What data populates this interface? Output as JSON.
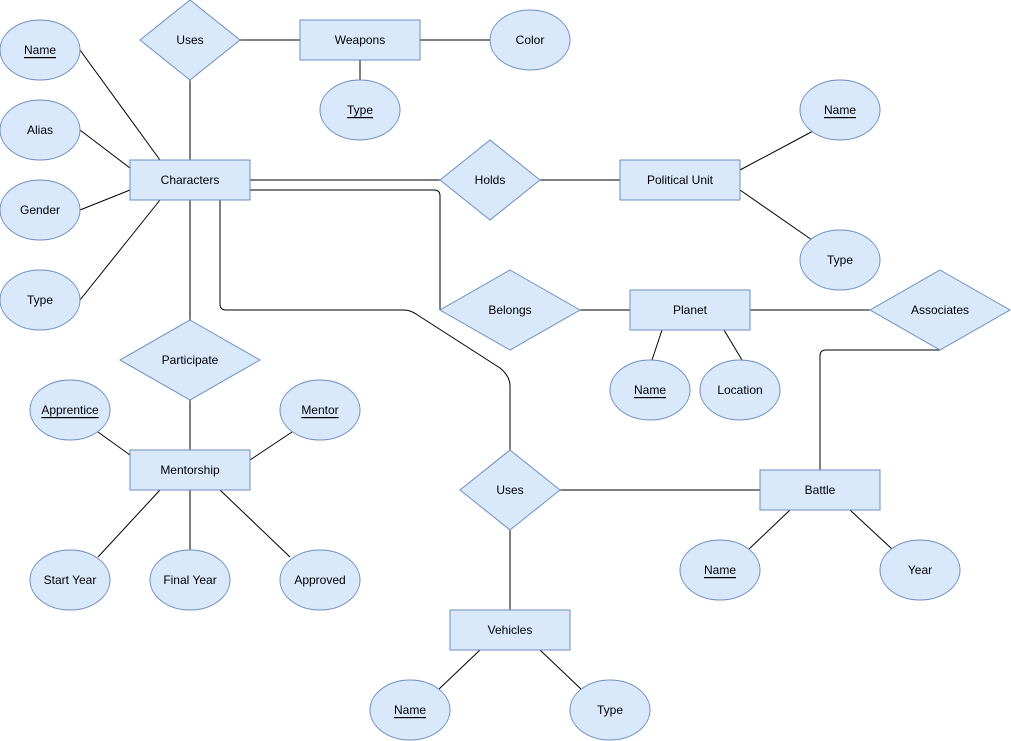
{
  "colors": {
    "fill": "#dae8fc",
    "stroke": "#6c8ebf",
    "edge": "#000000"
  },
  "entities": {
    "characters": "Characters",
    "weapons": "Weapons",
    "political_unit": "Political Unit",
    "planet": "Planet",
    "mentorship": "Mentorship",
    "battle": "Battle",
    "vehicles": "Vehicles"
  },
  "relationships": {
    "uses_weapons": "Uses",
    "holds": "Holds",
    "belongs": "Belongs",
    "associates": "Associates",
    "participate": "Participate",
    "uses_vehicles": "Uses"
  },
  "attributes": {
    "character_name": "Name",
    "character_alias": "Alias",
    "character_gender": "Gender",
    "character_type": "Type",
    "weapon_type": "Type",
    "weapon_color": "Color",
    "political_unit_name": "Name",
    "political_unit_type": "Type",
    "planet_name": "Name",
    "planet_location": "Location",
    "mentorship_apprentice": "Apprentice",
    "mentorship_mentor": "Mentor",
    "mentorship_start_year": "Start Year",
    "mentorship_final_year": "Final Year",
    "mentorship_approved": "Approved",
    "battle_name": "Name",
    "battle_year": "Year",
    "vehicle_name": "Name",
    "vehicle_type": "Type"
  }
}
